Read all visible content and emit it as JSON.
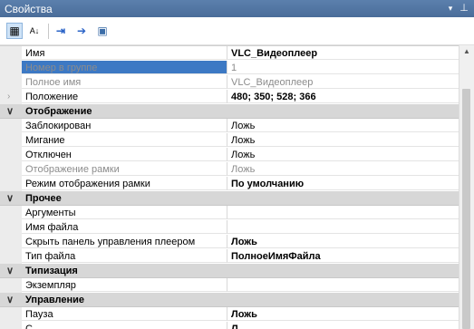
{
  "window": {
    "title": "Свойства",
    "menu_glyph": "▾",
    "pin_glyph": "⊥"
  },
  "toolbar": {
    "categorized_icon": "▦",
    "alpha_sort_icon": "A↓",
    "expand_icon": "⇥",
    "go_icon": "➔",
    "props_icon": "▣"
  },
  "grid": {
    "rows": [
      {
        "kind": "prop",
        "name": "Имя",
        "value": "VLC_Видеоплеер",
        "bold": true,
        "disabled": false,
        "selected": false
      },
      {
        "kind": "prop",
        "name": "Номер в группе",
        "value": "1",
        "bold": false,
        "disabled": true,
        "selected": true
      },
      {
        "kind": "prop",
        "name": "Полное имя",
        "value": "VLC_Видеоплеер",
        "bold": false,
        "disabled": true,
        "selected": false
      },
      {
        "kind": "prop",
        "name": "Положение",
        "value": "480; 350; 528; 366",
        "bold": true,
        "disabled": false,
        "selected": false,
        "expandable": true
      },
      {
        "kind": "cat",
        "name": "Отображение"
      },
      {
        "kind": "prop",
        "name": "Заблокирован",
        "value": "Ложь",
        "bold": false,
        "disabled": false,
        "selected": false
      },
      {
        "kind": "prop",
        "name": "Мигание",
        "value": "Ложь",
        "bold": false,
        "disabled": false,
        "selected": false
      },
      {
        "kind": "prop",
        "name": "Отключен",
        "value": "Ложь",
        "bold": false,
        "disabled": false,
        "selected": false
      },
      {
        "kind": "prop",
        "name": "Отображение рамки",
        "value": "Ложь",
        "bold": false,
        "disabled": true,
        "selected": false
      },
      {
        "kind": "prop",
        "name": "Режим отображения рамки",
        "value": "По умолчанию",
        "bold": true,
        "disabled": false,
        "selected": false
      },
      {
        "kind": "cat",
        "name": "Прочее"
      },
      {
        "kind": "prop",
        "name": "Аргументы",
        "value": "",
        "bold": false,
        "disabled": false,
        "selected": false
      },
      {
        "kind": "prop",
        "name": "Имя файла",
        "value": "",
        "bold": false,
        "disabled": false,
        "selected": false
      },
      {
        "kind": "prop",
        "name": "Скрыть панель управления плеером",
        "value": "Ложь",
        "bold": true,
        "disabled": false,
        "selected": false
      },
      {
        "kind": "prop",
        "name": "Тип файла",
        "value": "ПолноеИмяФайла",
        "bold": true,
        "disabled": false,
        "selected": false
      },
      {
        "kind": "cat",
        "name": "Типизация"
      },
      {
        "kind": "prop",
        "name": "Экземпляр",
        "value": "",
        "bold": false,
        "disabled": false,
        "selected": false
      },
      {
        "kind": "cat",
        "name": "Управление"
      },
      {
        "kind": "prop",
        "name": "Пауза",
        "value": "Ложь",
        "bold": true,
        "disabled": false,
        "selected": false
      },
      {
        "kind": "prop",
        "name": "С",
        "value": "Л",
        "bold": true,
        "disabled": false,
        "selected": false
      }
    ]
  },
  "scrollbar": {
    "up_glyph": "▲"
  },
  "glyphs": {
    "cat_chevron": "∨",
    "expander": "›"
  }
}
